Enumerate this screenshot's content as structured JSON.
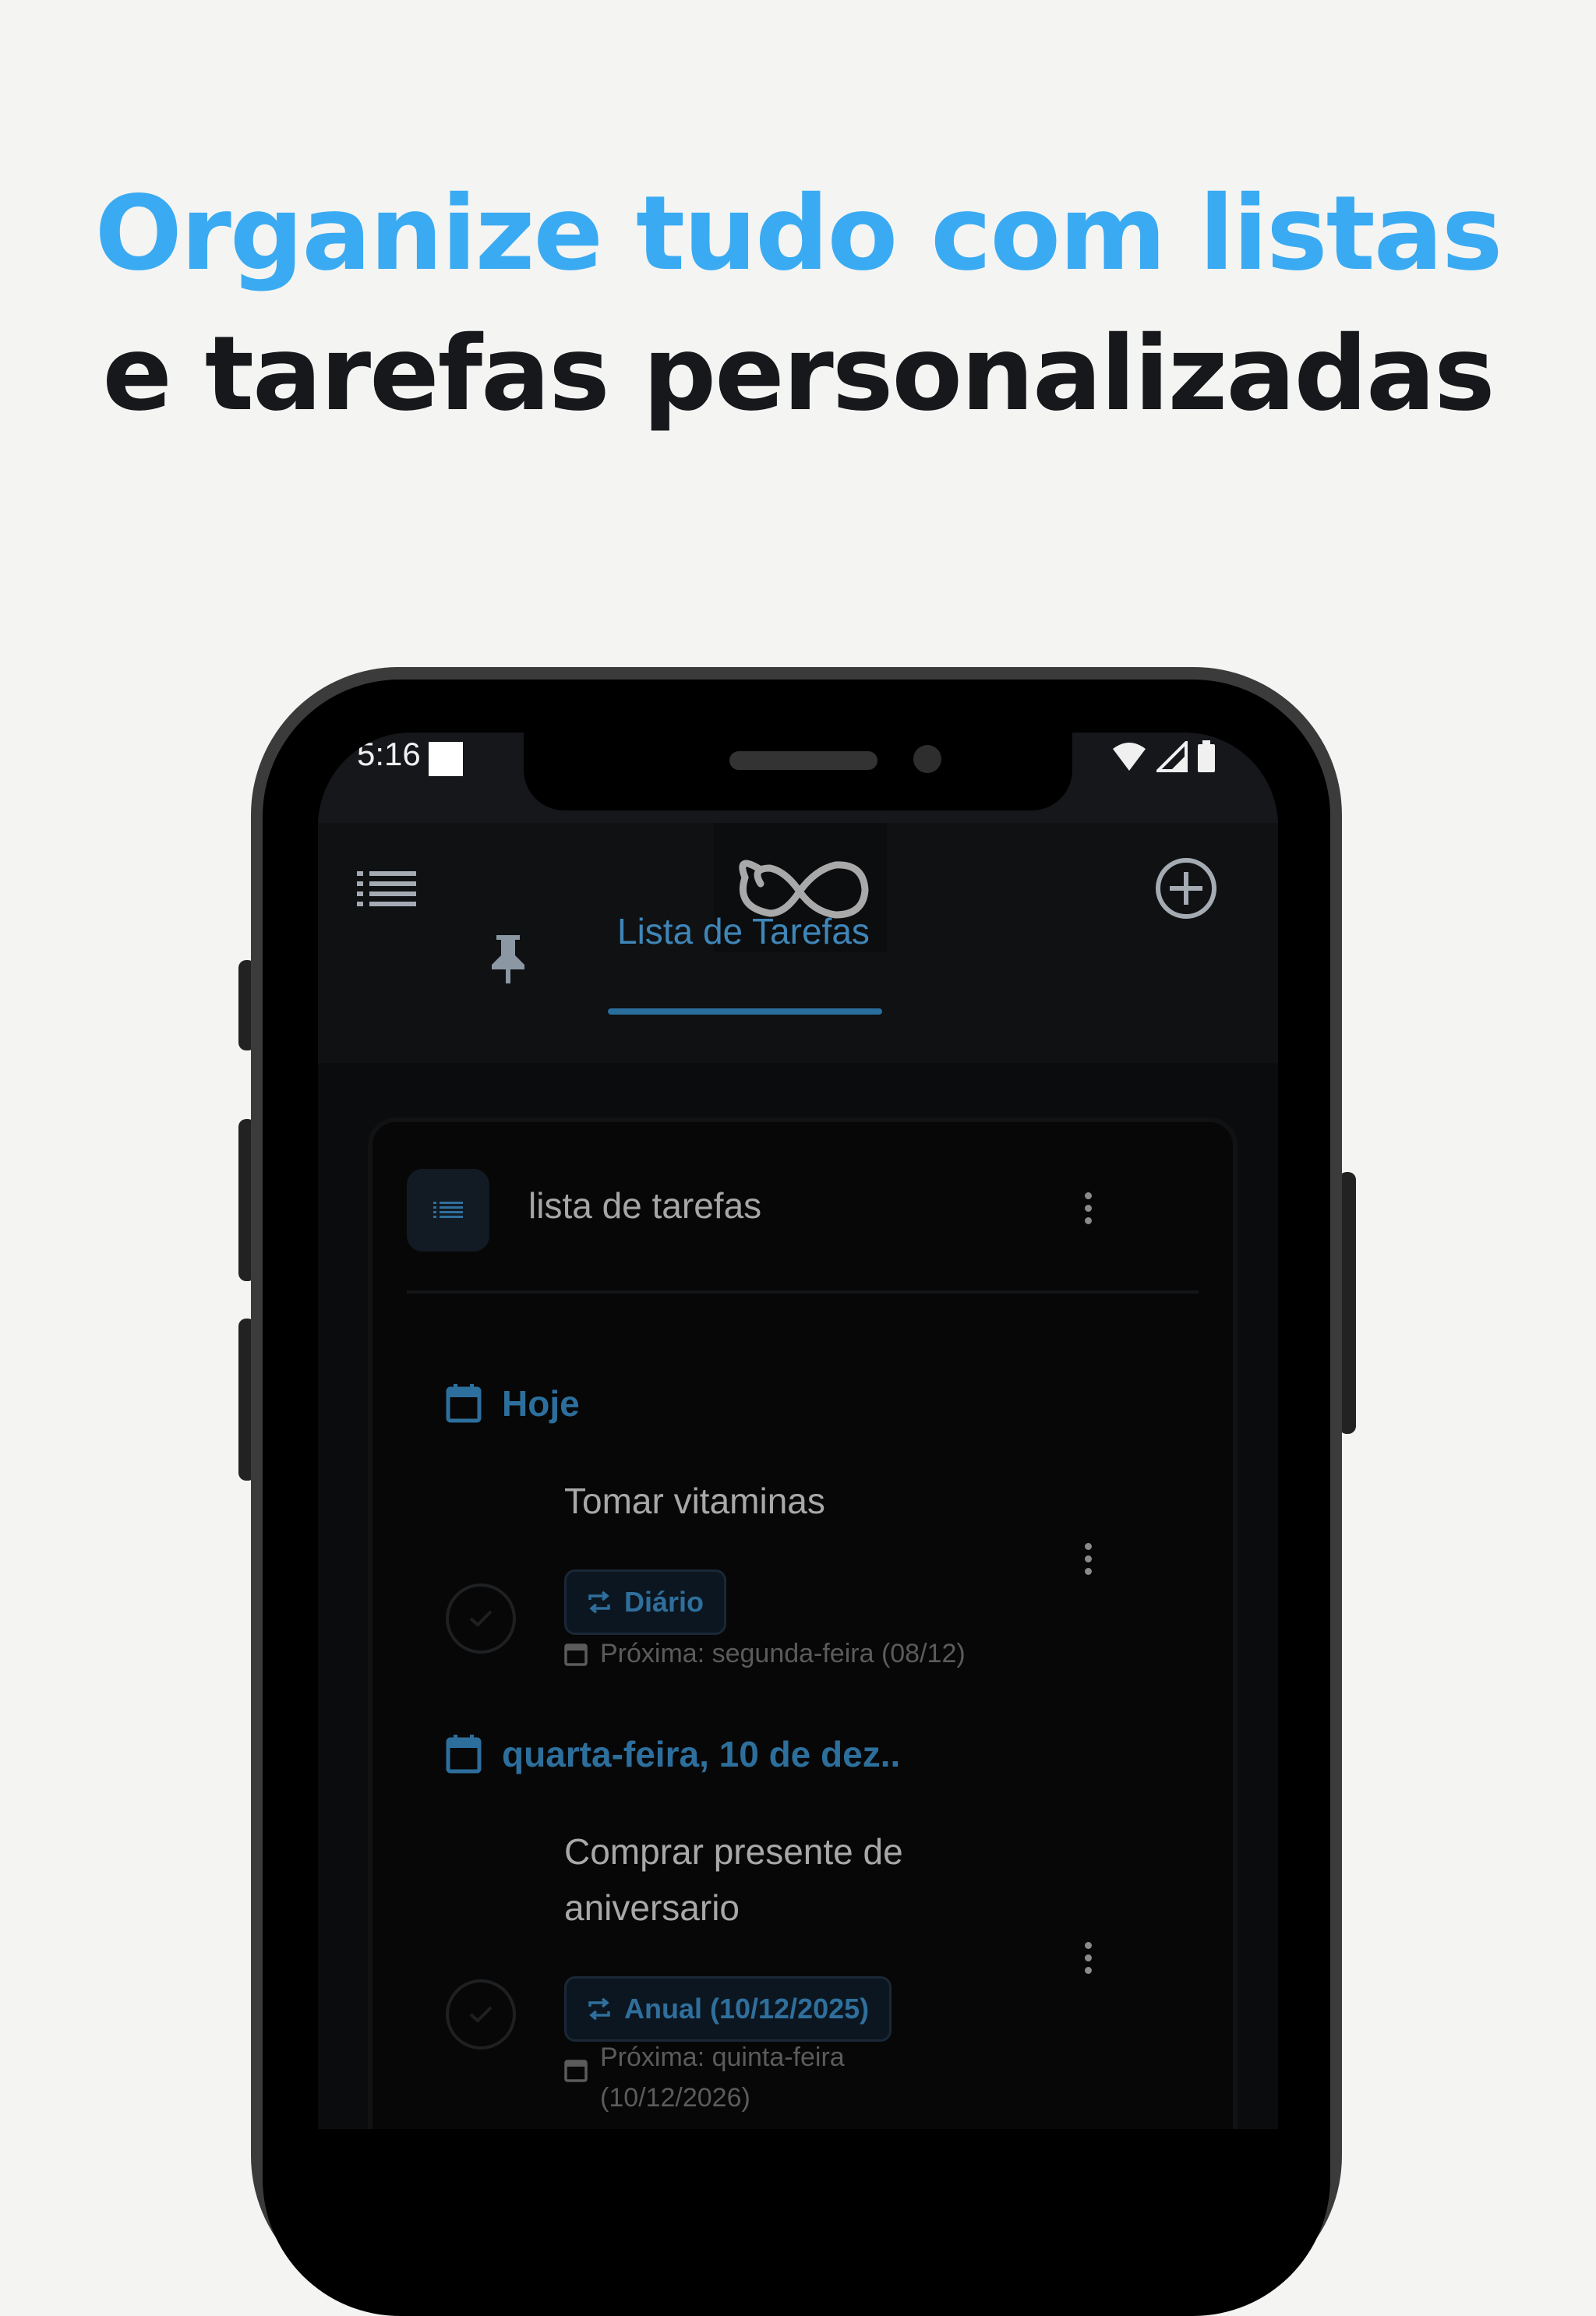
{
  "headline": {
    "line1": "Organize tudo com listas",
    "line2": "e tarefas personalizadas"
  },
  "status_bar": {
    "time": "5:16"
  },
  "tabs": [
    {
      "icon": "pin-icon"
    },
    {
      "label": "Lista de Tarefas",
      "selected": true
    }
  ],
  "list": {
    "title": "lista de tarefas",
    "sections": [
      {
        "heading": "Hoje",
        "tasks": [
          {
            "title": "Tomar vitaminas",
            "badge": "Diário",
            "next": "Próxima: segunda-feira (08/12)"
          }
        ]
      },
      {
        "heading": "quarta-feira, 10 de dez..",
        "tasks": [
          {
            "title_line1": "Comprar presente de",
            "title_line2": "aniversario",
            "badge": "Anual (10/12/2025)",
            "next_line1": "Próxima: quinta-feira",
            "next_line2": "(10/12/2026)"
          }
        ]
      }
    ]
  },
  "colors": {
    "accent": "#3aabf2",
    "headline_dark": "#16181c",
    "tab_active": "#3f86b8",
    "section_heading": "#2d6f9c",
    "screen_bg": "#0b0c0e"
  }
}
